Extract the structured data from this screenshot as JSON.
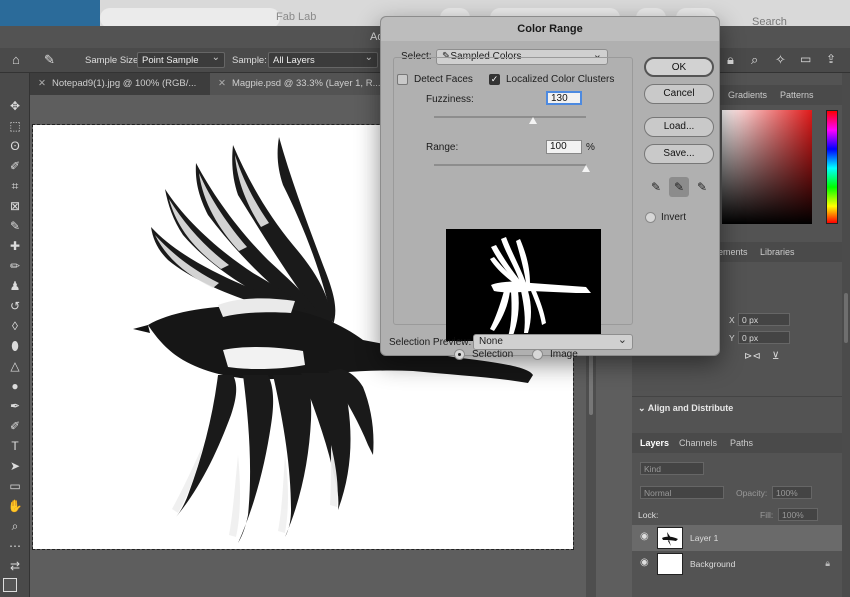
{
  "browser": {
    "title": "Fab Lab",
    "search": "Search"
  },
  "app": {
    "title_fragment": "Ad"
  },
  "options_bar": {
    "sample_size_label": "Sample Size:",
    "sample_size_value": "Point Sample",
    "sample_label": "Sample:",
    "sample_value": "All Layers"
  },
  "doc_tabs": [
    {
      "label": "Notepad9(1).jpg @ 100% (RGB/..."
    },
    {
      "label": "Magpie.psd @ 33.3% (Layer 1, R..."
    }
  ],
  "dialog": {
    "title": "Color Range",
    "select_label": "Select:",
    "select_value": "Sampled Colors",
    "detect_faces": "Detect Faces",
    "localized_clusters": "Localized Color Clusters",
    "fuzziness_label": "Fuzziness:",
    "fuzziness_value": "130",
    "fuzziness_fraction": 0.65,
    "range_label": "Range:",
    "range_value": "100",
    "range_unit": "%",
    "range_fraction": 1.0,
    "selection_radio": "Selection",
    "image_radio": "Image",
    "selection_preview_label": "Selection Preview:",
    "selection_preview_value": "None",
    "ok": "OK",
    "cancel": "Cancel",
    "load": "Load...",
    "save": "Save...",
    "invert": "Invert"
  },
  "right_panel": {
    "color_tabs": [
      "Gradients",
      "Patterns"
    ],
    "props_tabs": [
      "ements",
      "Libraries"
    ],
    "x_label": "X",
    "x_value": "0 px",
    "y_label": "Y",
    "y_value": "0 px",
    "align_distribute": "Align and Distribute",
    "layers_tabs": [
      "Layers",
      "Channels",
      "Paths"
    ],
    "kind": "Kind",
    "blend": "Normal",
    "opacity_label": "Opacity:",
    "opacity_value": "100%",
    "lock_label": "Lock:",
    "fill_label": "Fill:",
    "fill_value": "100%",
    "layers": [
      {
        "name": "Layer 1"
      },
      {
        "name": "Background"
      }
    ]
  }
}
